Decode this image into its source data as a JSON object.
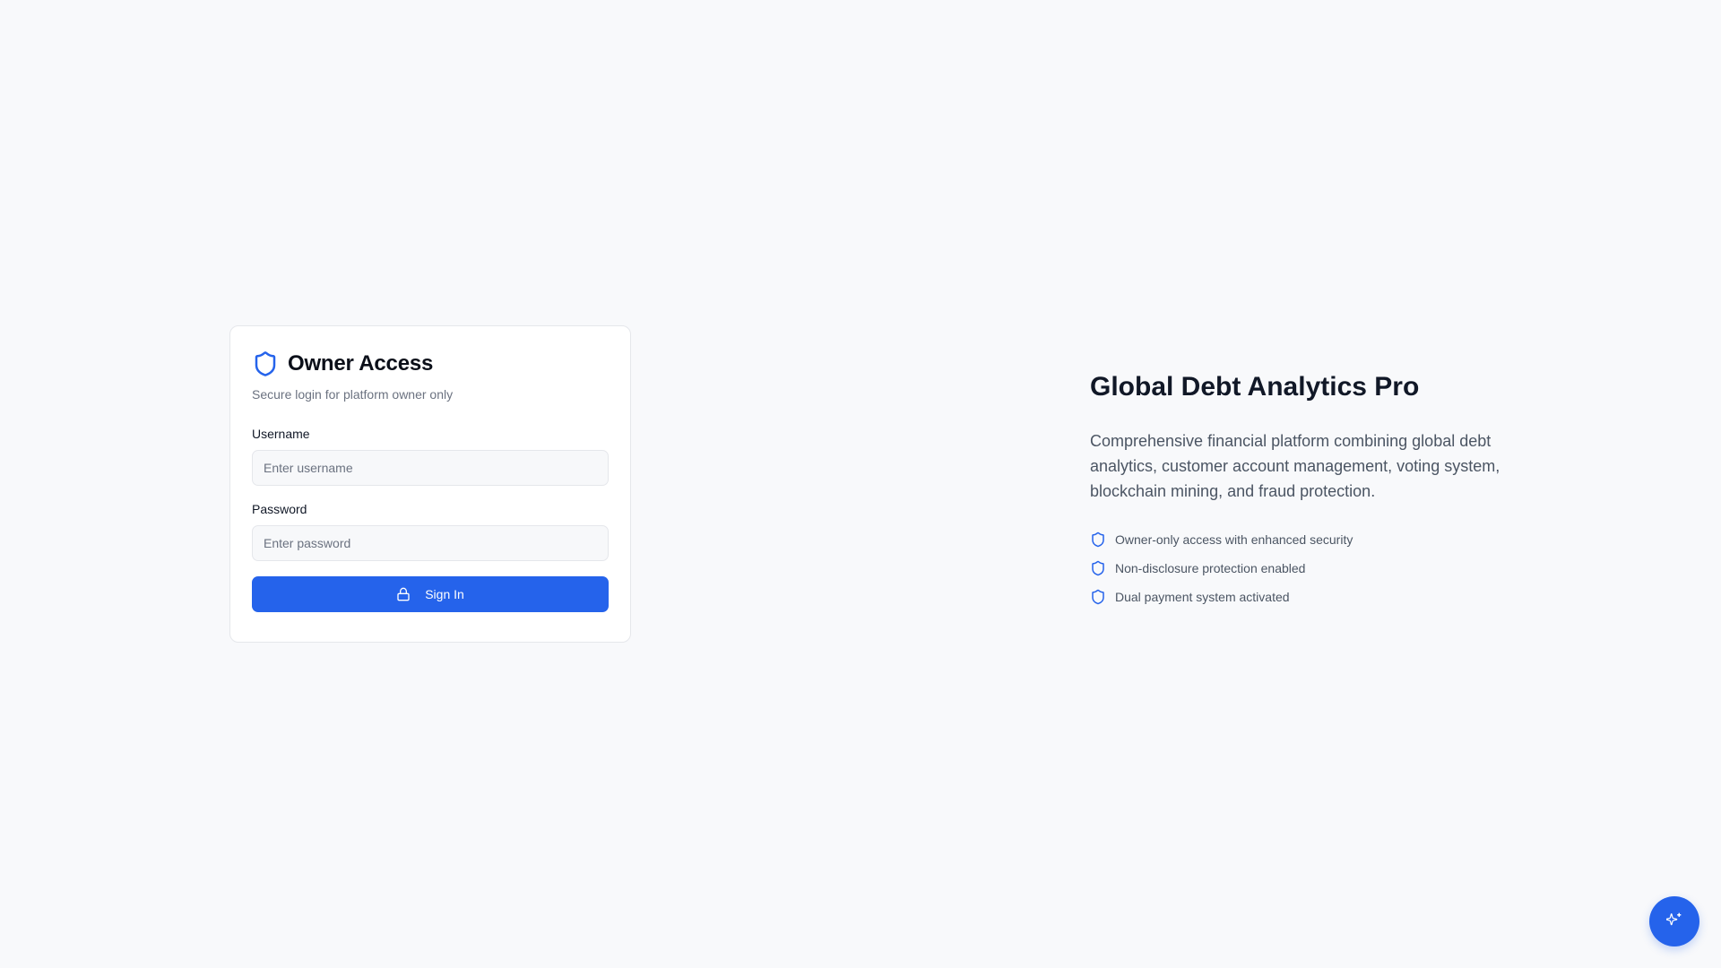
{
  "login": {
    "icon": "shield-icon",
    "title": "Owner Access",
    "subtitle": "Secure login for platform owner only",
    "username": {
      "label": "Username",
      "value": "",
      "placeholder": "Enter username"
    },
    "password": {
      "label": "Password",
      "value": "",
      "placeholder": "Enter password"
    },
    "submit": {
      "icon": "lock-icon",
      "label": "Sign In"
    }
  },
  "hero": {
    "title": "Global Debt Analytics Pro",
    "description": "Comprehensive financial platform combining global debt analytics, customer account management, voting system, blockchain mining, and fraud protection.",
    "features": [
      {
        "icon": "shield-icon",
        "text": "Owner-only access with enhanced security"
      },
      {
        "icon": "shield-icon",
        "text": "Non-disclosure protection enabled"
      },
      {
        "icon": "shield-icon",
        "text": "Dual payment system activated"
      }
    ]
  },
  "assistant_button": {
    "icon": "sparkles-icon"
  },
  "colors": {
    "accent": "#2563eb",
    "background": "#f8f9fb",
    "card": "#ffffff",
    "muted_text": "#6b7280"
  }
}
